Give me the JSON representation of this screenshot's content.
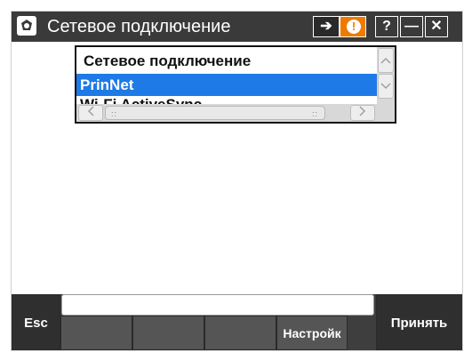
{
  "window": {
    "title": "Сетевое подключение",
    "buttons": {
      "help_label": "?",
      "minimize_label": "—",
      "close_label": "✕",
      "alert_label": "!",
      "arrow_label": "➔"
    },
    "icons": [
      "app-icon",
      "sync-arrow-icon",
      "alert-icon",
      "help-icon",
      "minimize-icon",
      "close-icon"
    ]
  },
  "list": {
    "header": "Сетевое подключение",
    "items": [
      {
        "label": "PrinNet",
        "selected": true
      },
      {
        "label": "Wi-Fi ActiveSync",
        "selected": false
      }
    ]
  },
  "scrollbars": {
    "up_glyph": "^",
    "down_glyph": "v",
    "left_glyph": "<",
    "right_glyph": ">",
    "grip": "::"
  },
  "input": {
    "value": ""
  },
  "softkeys": {
    "esc": "Esc",
    "f1": "",
    "f2": "",
    "f3": "",
    "f4": "Настройк",
    "accept": "Принять"
  },
  "colors": {
    "titlebar": "#3a3a3a",
    "selection": "#1e7ae6",
    "alert": "#f07a00"
  }
}
